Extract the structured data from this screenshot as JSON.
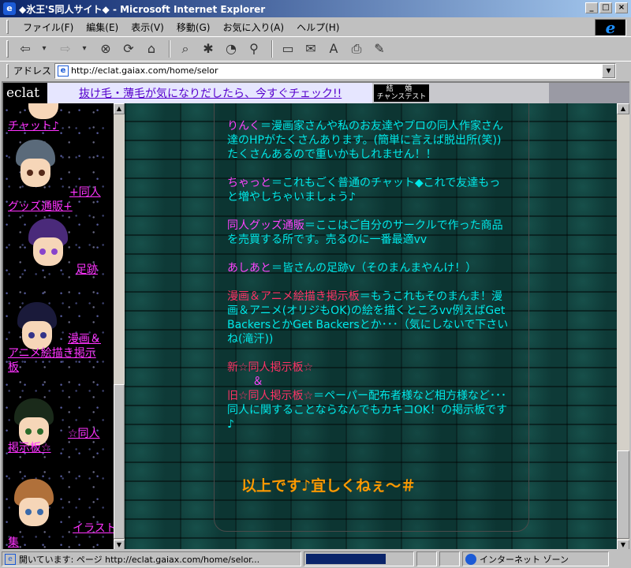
{
  "window": {
    "title": "◆氷王'S同人サイト◆ - Microsoft Internet Explorer",
    "controls": [
      "_",
      "□",
      "×"
    ]
  },
  "menu": [
    "ファイル(F)",
    "編集(E)",
    "表示(V)",
    "移動(G)",
    "お気に入り(A)",
    "ヘルプ(H)"
  ],
  "toolbar": {
    "icons": [
      "back-icon",
      "forward-icon",
      "stop-icon",
      "refresh-icon",
      "home-icon",
      "search-icon",
      "favorites-icon",
      "history-icon",
      "channels-icon",
      "fullscreen-icon",
      "mail-icon",
      "font-icon",
      "print-icon",
      "edit-icon"
    ]
  },
  "address": {
    "label": "アドレス",
    "url": "http://eclat.gaiax.com/home/selor"
  },
  "banner": {
    "logo": "eclat",
    "ad_text": "抜け毛・薄毛が気になりだしたら、今すぐチェック!!",
    "marriage_line1": "結 婚",
    "marriage_line2": "チャンステスト"
  },
  "left_nav": [
    {
      "label": "チャット♪"
    },
    {
      "label_a": "+同人",
      "label_b": "グッズ通販+"
    },
    {
      "label": "足跡"
    },
    {
      "label_a": "漫画＆",
      "label_b": "アニメ絵描き掲示",
      "label_c": "板"
    },
    {
      "label_a": "☆同人",
      "label_b": "掲示板☆"
    },
    {
      "label_a": "イラスト",
      "label_b": "集"
    }
  ],
  "content": {
    "p1_key": "りんく",
    "p1_text": "＝漫画家さんや私のお友達やプロの同人作家さん達のHPがたくさんあります。(簡単に言えば脱出所(笑))たくさんあるので重いかもしれません！！",
    "p2_key": "ちゃっと",
    "p2_text": "＝これもごく普通のチャット◆これで友達もっと増やしちゃいましょう♪",
    "p3_key": "同人グッズ通販",
    "p3_text": "＝ここはご自分のサークルで作った商品を売買する所です。売るのに一番最適vv",
    "p4_key": "あしあと",
    "p4_text": "＝皆さんの足跡v（そのまんまやんけ！）",
    "p5_key": "漫画＆アニメ絵描き掲示板",
    "p5_text": "＝もうこれもそのまんま！漫画＆アニメ(オリジもOK)の絵を描くところvv例えばGet BackersとかGet Backersとか･･･（気にしないで下さいね(滝汗))",
    "p6_new": "新☆同人掲示板☆",
    "p6_amp": "＆",
    "p6_old": "旧☆同人掲示板☆",
    "p6_text": "＝ペーパー配布者様など相方様など･･･同人に関することならなんでもカキコOK！の掲示板です♪",
    "closing": "以上です♪宜しくねぇ～＃"
  },
  "status": {
    "message": "開いています: ページ http://eclat.gaiax.com/home/selor...",
    "progress": 0.75,
    "zone": "インターネット ゾーン"
  },
  "colors": {
    "link": "#ff33ff",
    "body_text": "#00e8e8",
    "closing": "#ff9900",
    "title_bar": "#0a246a"
  }
}
